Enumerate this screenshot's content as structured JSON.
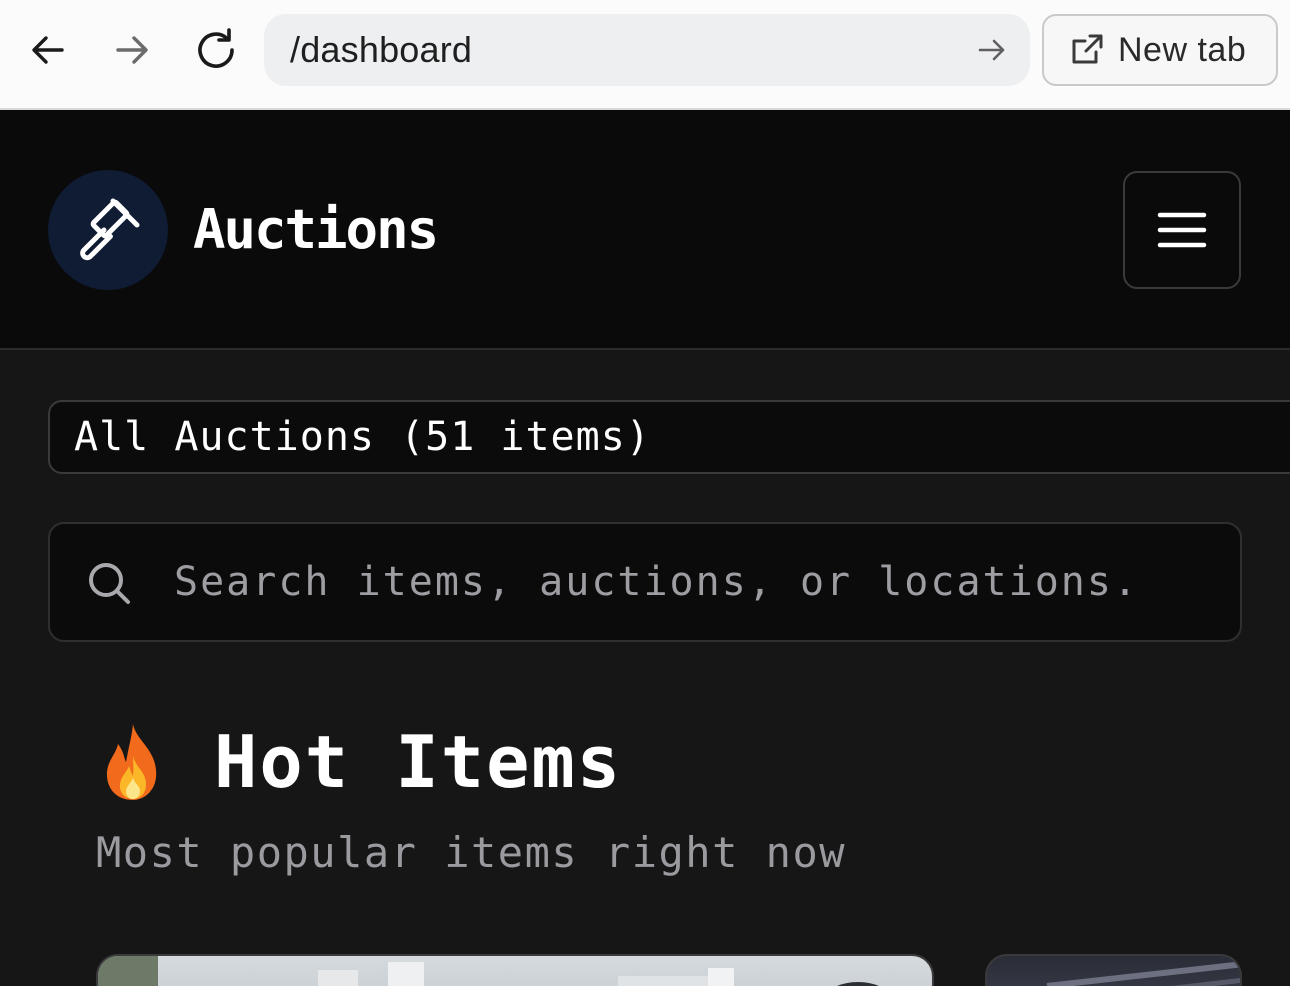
{
  "browser": {
    "url": "/dashboard",
    "new_tab_label": "New tab"
  },
  "header": {
    "brand": "Auctions",
    "logo_icon": "gavel-icon",
    "menu_icon": "hamburger-menu-icon"
  },
  "filter": {
    "selected": "All Auctions (51 items)"
  },
  "search": {
    "placeholder": "Search items, auctions, or locations."
  },
  "section": {
    "icon": "fire-emoji",
    "title": "Hot Items",
    "subtitle": "Most popular items right now"
  },
  "colors": {
    "page_bg": "#161617",
    "header_bg": "#0a0a0b",
    "logo_bg": "#0f1c33",
    "muted_text": "#9a9a9f"
  }
}
